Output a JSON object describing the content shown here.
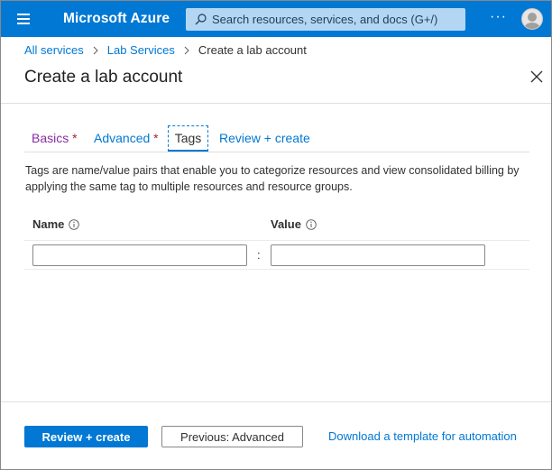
{
  "topbar": {
    "brand": "Microsoft Azure",
    "search_placeholder": "Search resources, services, and docs (G+/)",
    "more_label": "···"
  },
  "breadcrumb": {
    "items": [
      "All services",
      "Lab Services"
    ],
    "current": "Create a lab account"
  },
  "blade": {
    "title": "Create a lab account"
  },
  "tabs": [
    {
      "label": "Basics",
      "required": true
    },
    {
      "label": "Advanced",
      "required": true
    },
    {
      "label": "Tags",
      "required": false,
      "selected": true
    },
    {
      "label": "Review + create",
      "required": false
    }
  ],
  "required_marker": "*",
  "tags": {
    "description": "Tags are name/value pairs that enable you to categorize resources and view consolidated billing by applying the same tag to multiple resources and resource groups.",
    "name_header": "Name",
    "value_header": "Value",
    "separator": ":",
    "rows": [
      {
        "name": "",
        "value": ""
      }
    ]
  },
  "footer": {
    "review_create": "Review + create",
    "previous": "Previous: Advanced",
    "download_template": "Download a template for automation"
  },
  "colors": {
    "accent": "#0078d4",
    "visited_tab": "#8a2da5",
    "required": "#a4262c"
  }
}
